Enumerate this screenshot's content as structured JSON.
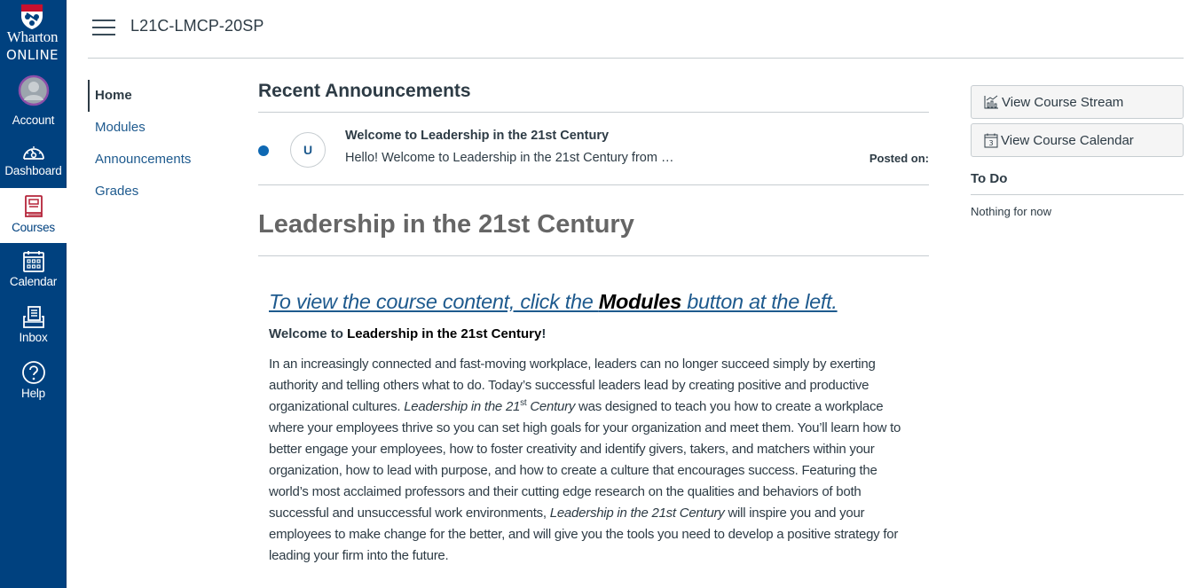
{
  "global_nav": {
    "logo": {
      "line1": "Wharton",
      "line2": "ONLINE"
    },
    "items": [
      {
        "id": "account",
        "label": "Account",
        "icon": "avatar-icon",
        "active": false
      },
      {
        "id": "dashboard",
        "label": "Dashboard",
        "icon": "speedometer-icon",
        "active": false
      },
      {
        "id": "courses",
        "label": "Courses",
        "icon": "book-icon",
        "active": true
      },
      {
        "id": "calendar",
        "label": "Calendar",
        "icon": "calendar-icon",
        "active": false
      },
      {
        "id": "inbox",
        "label": "Inbox",
        "icon": "inbox-icon",
        "active": false
      },
      {
        "id": "help",
        "label": "Help",
        "icon": "question-circle-icon",
        "active": false
      }
    ],
    "colors": {
      "background": "#00417f",
      "active_background": "#ffffff",
      "courses_icon": "#b5253a"
    }
  },
  "header": {
    "menu_icon": "hamburger-icon",
    "course_code": "L21C-LMCP-20SP"
  },
  "course_nav": {
    "items": [
      {
        "label": "Home",
        "active": true
      },
      {
        "label": "Modules",
        "active": false
      },
      {
        "label": "Announcements",
        "active": false
      },
      {
        "label": "Grades",
        "active": false
      }
    ]
  },
  "announcements": {
    "title": "Recent Announcements",
    "items": [
      {
        "unread": true,
        "avatar_initial": "U",
        "title": "Welcome to Leadership in the 21st Century",
        "preview": "Hello! Welcome to Leadership in the 21st Century from …",
        "posted_label": "Posted on:"
      }
    ]
  },
  "course": {
    "title": "Leadership in the 21st Century",
    "modules_link": {
      "before": "To view the course content, click the ",
      "bold": "Modules",
      "after": " button at the left."
    },
    "welcome": {
      "prefix": "Welcome to ",
      "bold": "Leadership in the 21st Century",
      "suffix": "!"
    },
    "body": {
      "p1_a": "In an increasingly connected and fast-moving workplace, leaders can no longer succeed simply by exerting authority and telling others what to do. Today’s successful leaders lead by creating positive and productive organizational cultures. ",
      "p1_italic_a": "Leadership in the 21",
      "p1_sup": "st",
      "p1_italic_b": " Century",
      "p1_b": " was designed to teach you how to create a workplace where your employees thrive so you can set high goals for your organization and meet them. You’ll learn how to better engage your employees, how to foster creativity and identify givers, takers, and matchers within your organization, how to lead with purpose, and how to create a culture that encourages success. Featuring the world’s most acclaimed professors and their cutting edge research on the qualities and behaviors of both successful and unsuccessful work environments, ",
      "p1_italic_c": "Leadership in the 21st Century",
      "p1_c": " will inspire you and your employees to make change for the better, and will give you the tools you need to develop a positive strategy for leading your firm into the future."
    }
  },
  "sidebar": {
    "buttons": [
      {
        "label": "View Course Stream",
        "icon": "chart-icon"
      },
      {
        "label": "View Course Calendar",
        "icon": "calendar-small-icon"
      }
    ],
    "todo": {
      "title": "To Do",
      "empty_text": "Nothing for now"
    }
  }
}
